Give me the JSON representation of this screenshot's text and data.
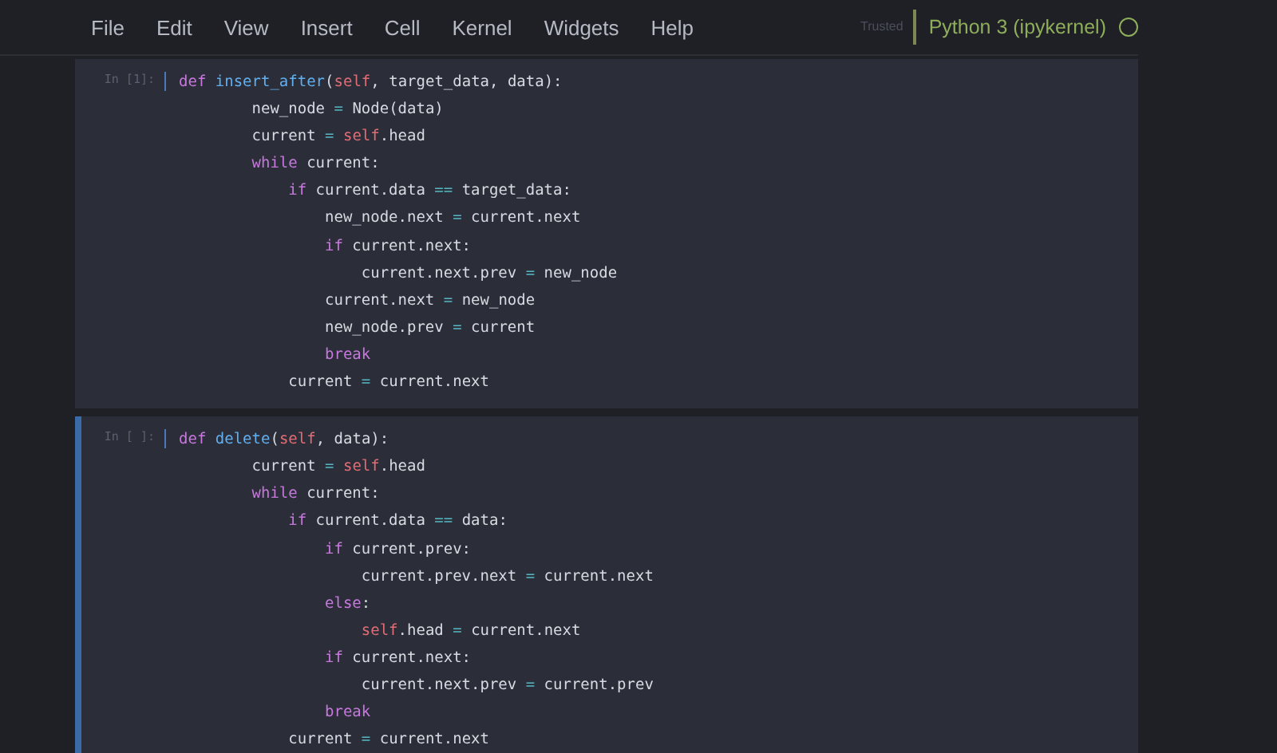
{
  "menu": [
    {
      "label": "File"
    },
    {
      "label": "Edit"
    },
    {
      "label": "View"
    },
    {
      "label": "Insert"
    },
    {
      "label": "Cell"
    },
    {
      "label": "Kernel"
    },
    {
      "label": "Widgets"
    },
    {
      "label": "Help"
    }
  ],
  "trusted": "Trusted",
  "kernel": {
    "name": "Python 3 (ipykernel)",
    "busy": false
  },
  "cells": [
    {
      "prompt": "In [1]:",
      "selected": false,
      "lines": [
        [
          {
            "kind": "kw",
            "text": "def "
          },
          {
            "kind": "fn",
            "text": "insert_after"
          },
          {
            "kind": "plain",
            "text": "("
          },
          {
            "kind": "self",
            "text": "self"
          },
          {
            "kind": "plain",
            "text": ", target_data, data):"
          }
        ],
        [
          {
            "kind": "plain",
            "text": "        new_node "
          },
          {
            "kind": "op",
            "text": "="
          },
          {
            "kind": "plain",
            "text": " Node(data)"
          }
        ],
        [
          {
            "kind": "plain",
            "text": "        current "
          },
          {
            "kind": "op",
            "text": "="
          },
          {
            "kind": "self",
            "text": " self"
          },
          {
            "kind": "plain",
            "text": ".head"
          }
        ],
        [
          {
            "kind": "kw",
            "text": "        while"
          },
          {
            "kind": "plain",
            "text": " current:"
          }
        ],
        [
          {
            "kind": "kw",
            "text": "            if"
          },
          {
            "kind": "plain",
            "text": " current.data "
          },
          {
            "kind": "op",
            "text": "=="
          },
          {
            "kind": "plain",
            "text": " target_data:"
          }
        ],
        [
          {
            "kind": "plain",
            "text": "                new_node.next "
          },
          {
            "kind": "op",
            "text": "="
          },
          {
            "kind": "plain",
            "text": " current.next"
          }
        ],
        [
          {
            "kind": "kw",
            "text": "                if"
          },
          {
            "kind": "plain",
            "text": " current.next:"
          }
        ],
        [
          {
            "kind": "plain",
            "text": "                    current.next.prev "
          },
          {
            "kind": "op",
            "text": "="
          },
          {
            "kind": "plain",
            "text": " new_node"
          }
        ],
        [
          {
            "kind": "plain",
            "text": "                current.next "
          },
          {
            "kind": "op",
            "text": "="
          },
          {
            "kind": "plain",
            "text": " new_node"
          }
        ],
        [
          {
            "kind": "plain",
            "text": "                new_node.prev "
          },
          {
            "kind": "op",
            "text": "="
          },
          {
            "kind": "plain",
            "text": " current"
          }
        ],
        [
          {
            "kind": "kw",
            "text": "                break"
          }
        ],
        [
          {
            "kind": "plain",
            "text": "            current "
          },
          {
            "kind": "op",
            "text": "="
          },
          {
            "kind": "plain",
            "text": " current.next"
          }
        ]
      ]
    },
    {
      "prompt": "In [ ]:",
      "selected": true,
      "lines": [
        [
          {
            "kind": "kw",
            "text": "def "
          },
          {
            "kind": "fn",
            "text": "delete"
          },
          {
            "kind": "plain",
            "text": "("
          },
          {
            "kind": "self",
            "text": "self"
          },
          {
            "kind": "plain",
            "text": ", data):"
          }
        ],
        [
          {
            "kind": "plain",
            "text": "        current "
          },
          {
            "kind": "op",
            "text": "="
          },
          {
            "kind": "self",
            "text": " self"
          },
          {
            "kind": "plain",
            "text": ".head"
          }
        ],
        [
          {
            "kind": "kw",
            "text": "        while"
          },
          {
            "kind": "plain",
            "text": " current:"
          }
        ],
        [
          {
            "kind": "kw",
            "text": "            if"
          },
          {
            "kind": "plain",
            "text": " current.data "
          },
          {
            "kind": "op",
            "text": "=="
          },
          {
            "kind": "plain",
            "text": " data:"
          }
        ],
        [
          {
            "kind": "kw",
            "text": "                if"
          },
          {
            "kind": "plain",
            "text": " current.prev:"
          }
        ],
        [
          {
            "kind": "plain",
            "text": "                    current.prev.next "
          },
          {
            "kind": "op",
            "text": "="
          },
          {
            "kind": "plain",
            "text": " current.next"
          }
        ],
        [
          {
            "kind": "kw",
            "text": "                else"
          },
          {
            "kind": "plain",
            "text": ":"
          }
        ],
        [
          {
            "kind": "self",
            "text": "                    self"
          },
          {
            "kind": "plain",
            "text": ".head "
          },
          {
            "kind": "op",
            "text": "="
          },
          {
            "kind": "plain",
            "text": " current.next"
          }
        ],
        [
          {
            "kind": "kw",
            "text": "                if"
          },
          {
            "kind": "plain",
            "text": " current.next:"
          }
        ],
        [
          {
            "kind": "plain",
            "text": "                    current.next.prev "
          },
          {
            "kind": "op",
            "text": "="
          },
          {
            "kind": "plain",
            "text": " current.prev"
          }
        ],
        [
          {
            "kind": "kw",
            "text": "                break"
          }
        ],
        [
          {
            "kind": "plain",
            "text": "            current "
          },
          {
            "kind": "op",
            "text": "="
          },
          {
            "kind": "plain",
            "text": " current.next"
          }
        ]
      ]
    }
  ]
}
